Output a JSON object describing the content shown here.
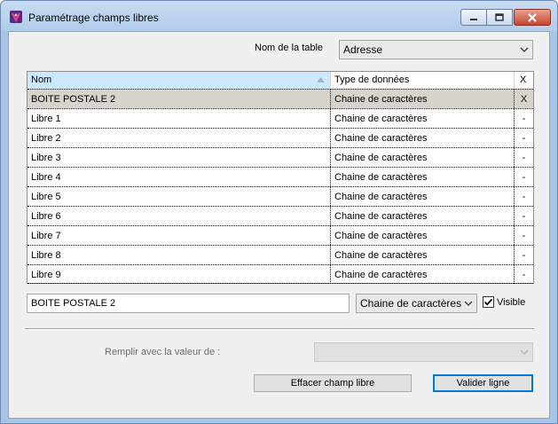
{
  "window": {
    "title": "Paramétrage champs libres"
  },
  "table_selector": {
    "label": "Nom de la table",
    "value": "Adresse"
  },
  "grid": {
    "headers": [
      "Nom",
      "Type de données",
      "X"
    ],
    "rows": [
      {
        "nom": "BOITE POSTALE 2",
        "type": "Chaine de caractères",
        "x": "X"
      },
      {
        "nom": "Libre 1",
        "type": "Chaine de caractères",
        "x": "-"
      },
      {
        "nom": "Libre 2",
        "type": "Chaine de caractères",
        "x": "-"
      },
      {
        "nom": "Libre 3",
        "type": "Chaine de caractères",
        "x": "-"
      },
      {
        "nom": "Libre 4",
        "type": "Chaine de caractères",
        "x": "-"
      },
      {
        "nom": "Libre 5",
        "type": "Chaine de caractères",
        "x": "-"
      },
      {
        "nom": "Libre 6",
        "type": "Chaine de caractères",
        "x": "-"
      },
      {
        "nom": "Libre 7",
        "type": "Chaine de caractères",
        "x": "-"
      },
      {
        "nom": "Libre 8",
        "type": "Chaine de caractères",
        "x": "-"
      },
      {
        "nom": "Libre 9",
        "type": "Chaine de caractères",
        "x": "-"
      }
    ]
  },
  "editor": {
    "name_value": "BOITE POSTALE 2",
    "type_value": "Chaine de caractères",
    "visible_label": "Visible",
    "visible_checked": true
  },
  "fill": {
    "label": "Remplir avec la valeur de :",
    "value": ""
  },
  "buttons": {
    "clear_label": "Effacer champ libre",
    "validate_label": "Valider ligne"
  },
  "colors": {
    "selected_row": "#d7d4cd",
    "sorted_header": "#cce8ff",
    "default_button_border": "#0078d7"
  }
}
